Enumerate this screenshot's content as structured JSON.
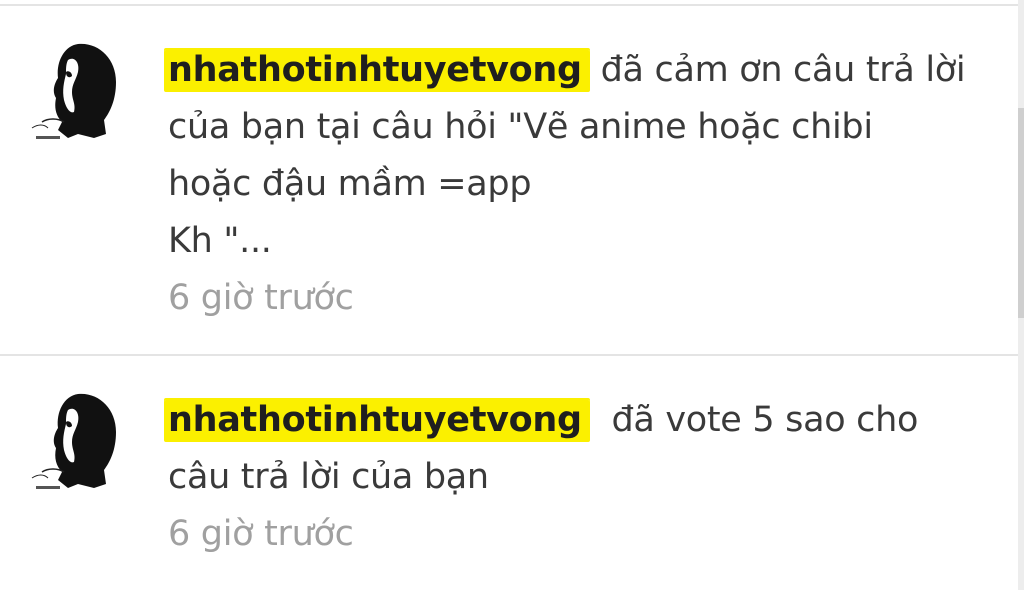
{
  "notifications": [
    {
      "user": "nhathotinhtuyetvong",
      "message_lines": [
        "đã cảm ơn câu trả lời",
        "của bạn tại câu hỏi \"Vẽ anime hoặc chibi",
        "hoặc đậu mầm =app",
        "Kh \"..."
      ],
      "time": "6 giờ trước",
      "avatar_icon": "user-silhouette-avatar"
    },
    {
      "user": "nhathotinhtuyetvong",
      "message_lines": [
        "đã vote 5 sao cho",
        "câu trả lời của bạn"
      ],
      "time": "6 giờ trước",
      "avatar_icon": "user-silhouette-avatar"
    }
  ],
  "colors": {
    "highlight": "#fbf000",
    "text": "#3a3a3a",
    "muted": "#a0a0a0",
    "divider": "#e4e4e4"
  }
}
